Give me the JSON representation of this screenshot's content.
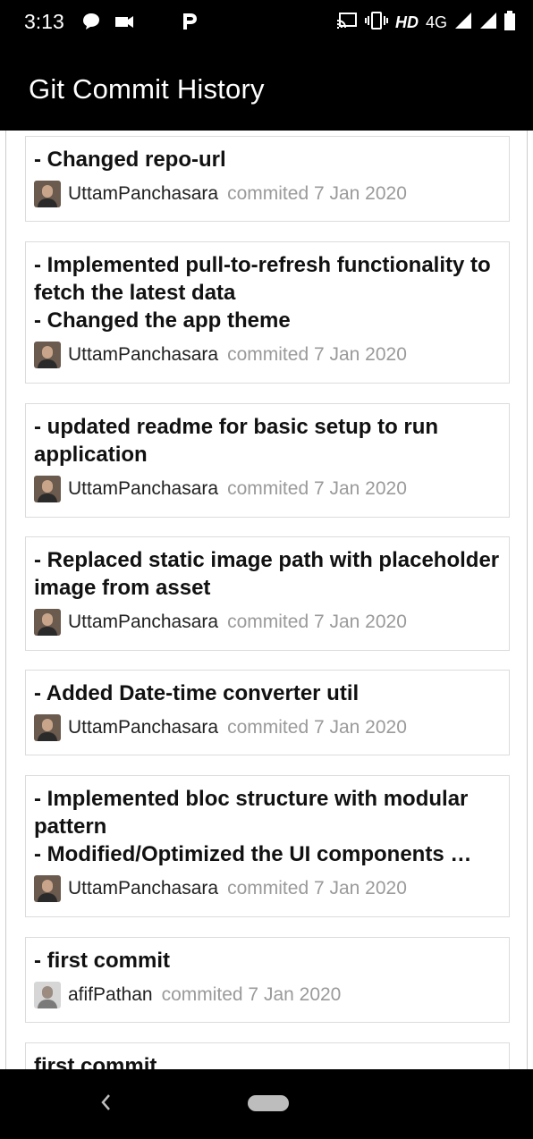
{
  "status_bar": {
    "time": "3:13",
    "network": "HD",
    "signal": "4G",
    "left_icons": [
      "chat-bubble-icon",
      "video-camera-icon",
      "pocketcasts-p-icon"
    ],
    "right_icons": [
      "cast-icon",
      "vibrate-icon",
      "signal-icon",
      "wifi-signal-icon",
      "battery-icon"
    ]
  },
  "app_bar": {
    "title": "Git Commit History"
  },
  "commits": [
    {
      "message": "- Changed repo-url",
      "author": "UttamPanchasara",
      "committed": "commited 7 Jan 2020",
      "avatar": "person-photo"
    },
    {
      "message": "- Implemented pull-to-refresh functionality to fetch the latest data\n- Changed the app theme",
      "author": "UttamPanchasara",
      "committed": "commited 7 Jan 2020",
      "avatar": "person-photo"
    },
    {
      "message": "- updated readme for basic setup to run application",
      "author": "UttamPanchasara",
      "committed": "commited 7 Jan 2020",
      "avatar": "person-photo"
    },
    {
      "message": "- Replaced static image path with placeholder image from asset",
      "author": "UttamPanchasara",
      "committed": "commited 7 Jan 2020",
      "avatar": "person-photo"
    },
    {
      "message": "- Added Date-time converter util",
      "author": "UttamPanchasara",
      "committed": "commited 7 Jan 2020",
      "avatar": "person-photo"
    },
    {
      "message": "- Implemented bloc structure with modular pattern\n- Modified/Optimized the UI components …",
      "author": "UttamPanchasara",
      "committed": "commited 7 Jan 2020",
      "avatar": "person-photo"
    },
    {
      "message": "- first commit",
      "author": "afifPathan",
      "committed": "commited 7 Jan 2020",
      "avatar": "person-photo-alt"
    },
    {
      "message": "first commit",
      "author": "",
      "committed": "",
      "avatar": ""
    }
  ],
  "nav": {
    "back_icon": "back-chevron-icon",
    "home_icon": "home-pill-icon"
  }
}
